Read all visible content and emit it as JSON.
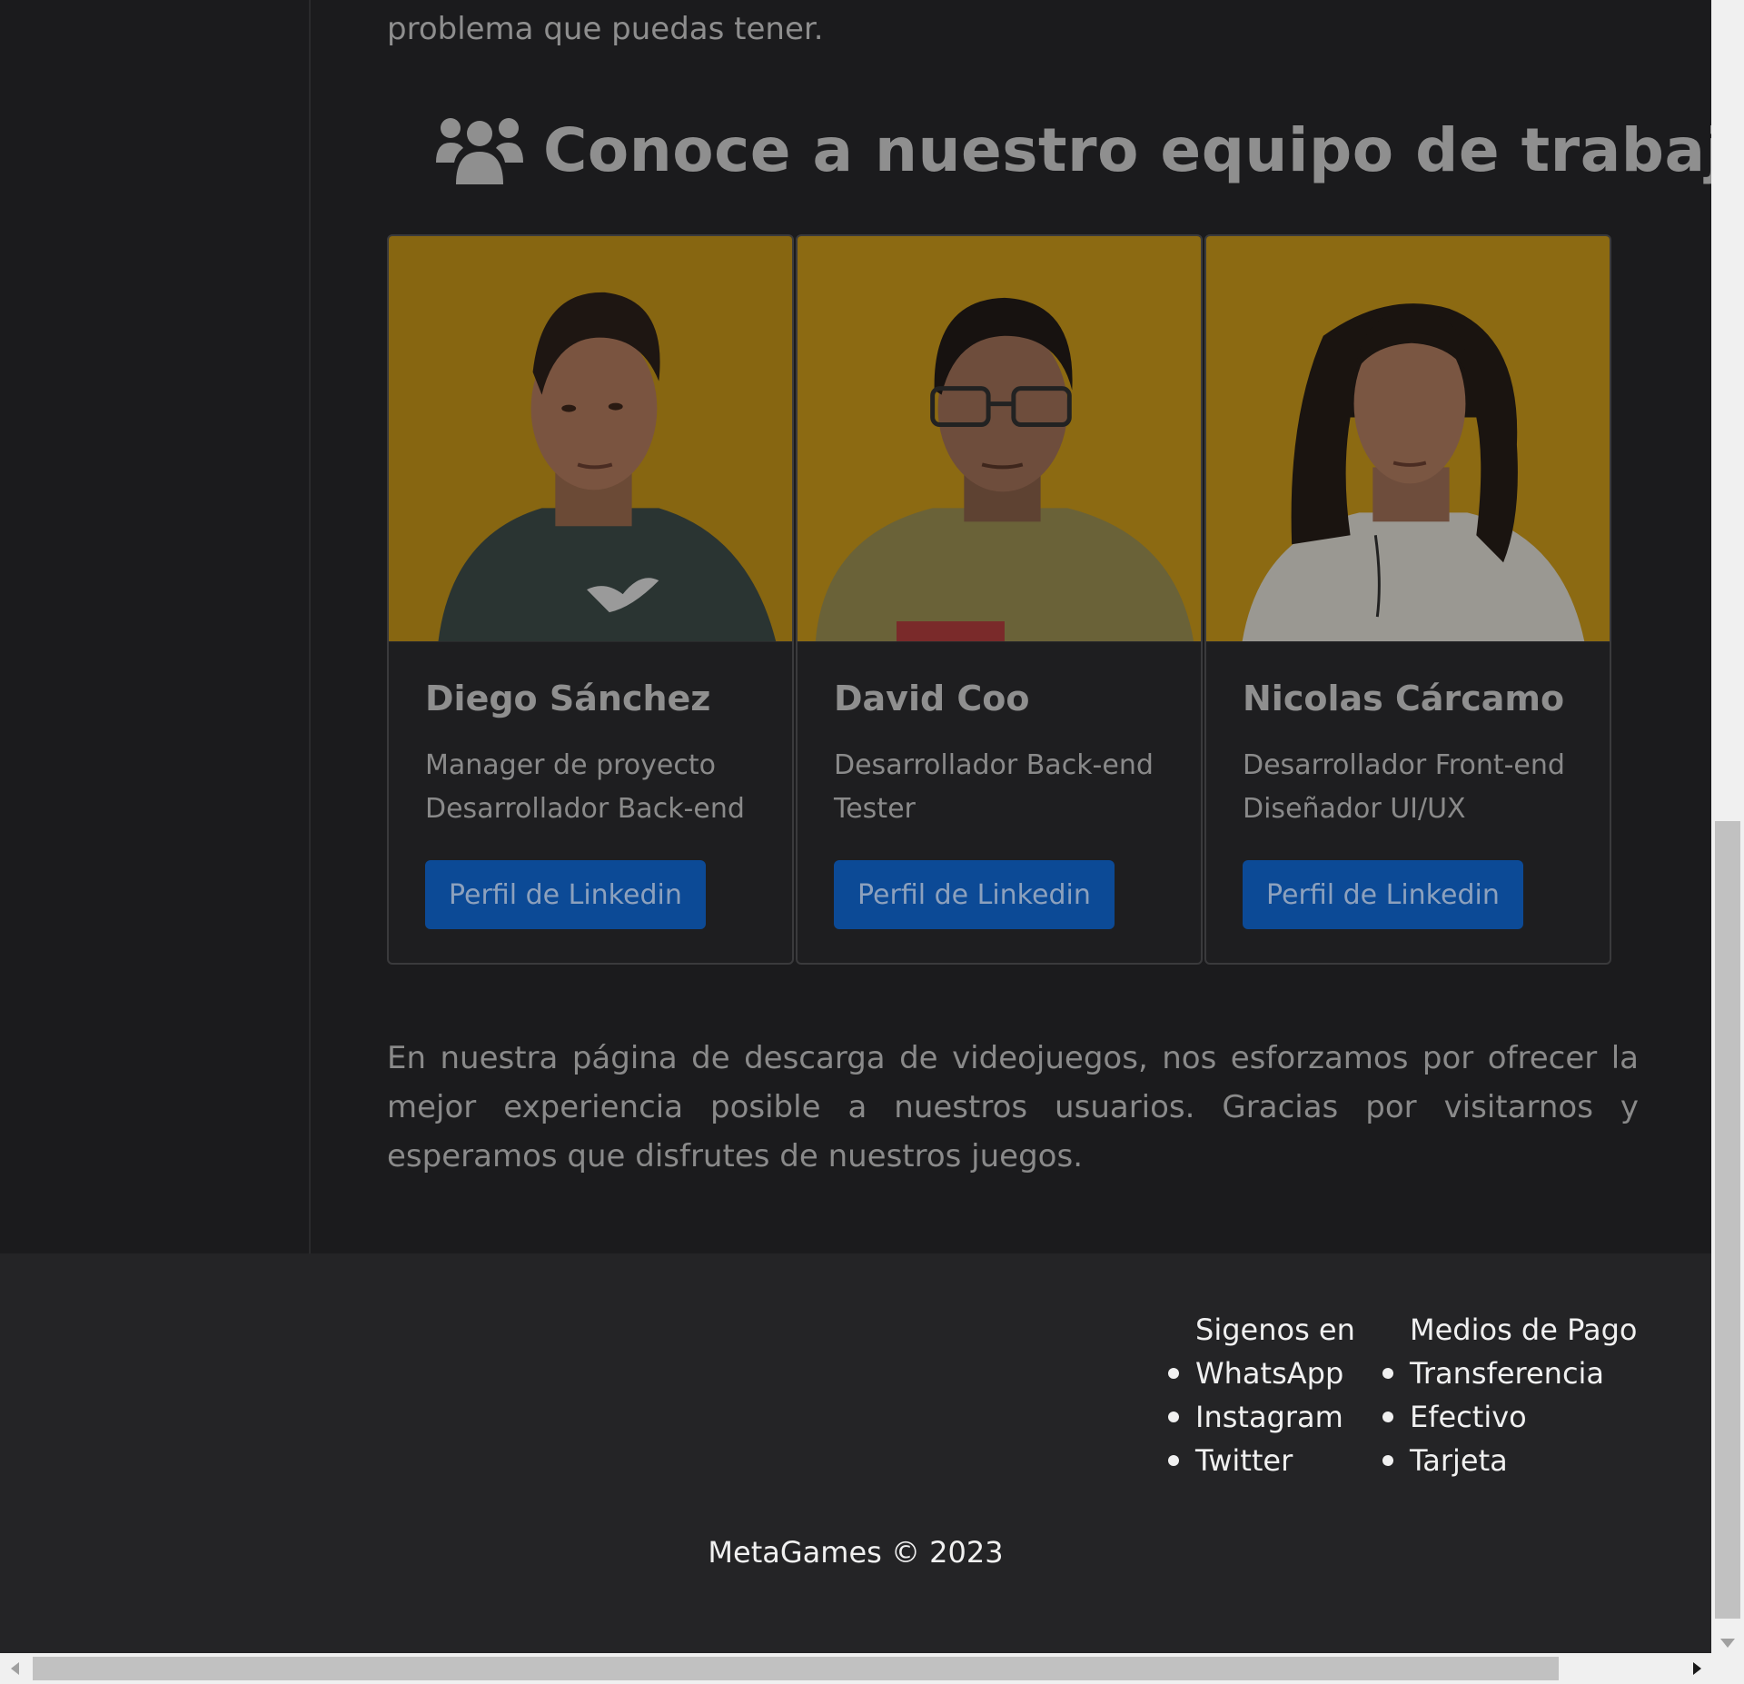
{
  "intro": {
    "tail_text": "problema que puedas tener."
  },
  "team": {
    "heading": "Conoce a nuestro equipo de trabajo",
    "icon": "users-icon",
    "members": [
      {
        "name": "Diego Sánchez",
        "role_line_1": "Manager de proyecto",
        "role_line_2": "Desarrollador Back-end",
        "button_label": "Perfil de Linkedin",
        "photo": "person-photo-green-hoodie"
      },
      {
        "name": "David Coo",
        "role_line_1": "Desarrollador Back-end",
        "role_line_2": "Tester",
        "button_label": "Perfil de Linkedin",
        "photo": "person-photo-glasses-olive-sweater"
      },
      {
        "name": "Nicolas Cárcamo",
        "role_line_1": "Desarrollador Front-end",
        "role_line_2": "Diseñador UI/UX",
        "button_label": "Perfil de Linkedin",
        "photo": "person-photo-long-hair-white-hoodie"
      }
    ]
  },
  "closing_text": "En nuestra página de descarga de videojuegos, nos esforzamos por ofrecer la mejor experiencia posible a nuestros usuarios. Gracias por visitarnos y esperamos que disfrutes de nuestros juegos.",
  "footer": {
    "social": {
      "title": "Sigenos en",
      "items": [
        "WhatsApp",
        "Instagram",
        "Twitter"
      ]
    },
    "payment": {
      "title": "Medios de Pago",
      "items": [
        "Transferencia",
        "Efectivo",
        "Tarjeta"
      ]
    },
    "copyright": "MetaGames © 2023"
  },
  "colors": {
    "page_bg": "#1b1b1d",
    "footer_bg": "#242426",
    "button_bg": "#0c4a96",
    "photo_backdrop": "#8c6a12"
  }
}
